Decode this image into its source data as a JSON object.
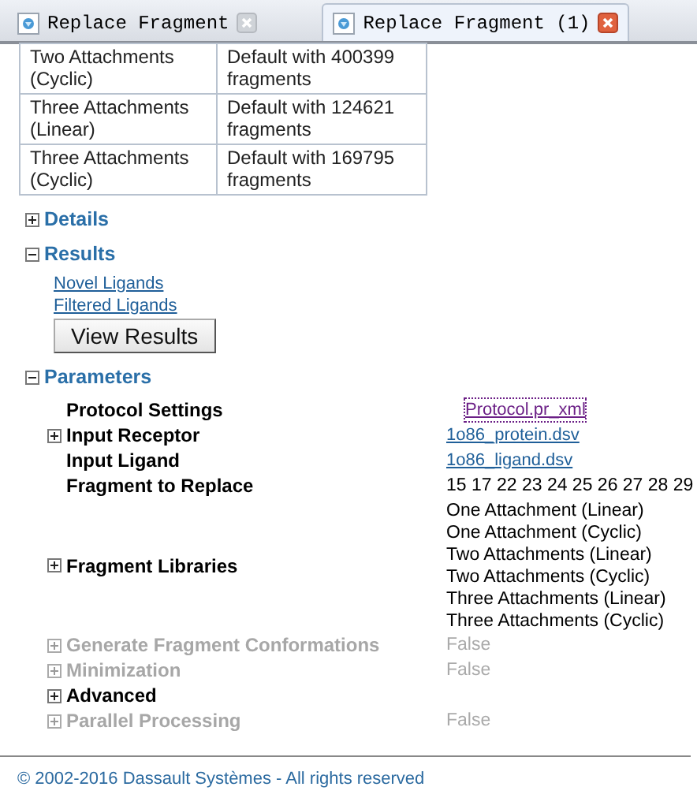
{
  "tabs": [
    {
      "title": "Replace Fragment",
      "selected": false
    },
    {
      "title": "Replace Fragment (1)",
      "selected": true
    }
  ],
  "libraries_table": {
    "rows": [
      {
        "library": "Two Attachments (Cyclic)",
        "description": "Default with 400399 fragments"
      },
      {
        "library": "Three Attachments (Linear)",
        "description": "Default with 124621 fragments"
      },
      {
        "library": "Three Attachments (Cyclic)",
        "description": "Default with 169795 fragments"
      }
    ]
  },
  "sections": [
    {
      "title": "Details",
      "expanded": false
    },
    {
      "title": "Results",
      "expanded": true,
      "links": [
        "Novel Ligands",
        "Filtered Ligands"
      ],
      "button": "View Results"
    },
    {
      "title": "Parameters",
      "expanded": true,
      "parameters": [
        {
          "label": "Protocol Settings",
          "expandable": false,
          "disabled": false,
          "kind": "link",
          "value": "Protocol.pr_xml",
          "visited": true
        },
        {
          "label": "Input Receptor",
          "expandable": true,
          "disabled": false,
          "kind": "link",
          "value": "1o86_protein.dsv",
          "visited": false
        },
        {
          "label": "Input Ligand",
          "expandable": false,
          "disabled": false,
          "kind": "link",
          "value": "1o86_ligand.dsv",
          "visited": false
        },
        {
          "label": "Fragment to Replace",
          "expandable": false,
          "disabled": false,
          "kind": "text",
          "value": "15 17 22 23 24 25 26 27 28 29"
        },
        {
          "label": "Fragment Libraries",
          "expandable": true,
          "disabled": false,
          "kind": "list",
          "values": [
            "One Attachment (Linear)",
            "One Attachment (Cyclic)",
            "Two Attachments (Linear)",
            "Two Attachments (Cyclic)",
            "Three Attachments (Linear)",
            "Three Attachments (Cyclic)"
          ]
        },
        {
          "label": "Generate Fragment Conformations",
          "expandable": true,
          "disabled": true,
          "kind": "text",
          "value": "False"
        },
        {
          "label": "Minimization",
          "expandable": true,
          "disabled": true,
          "kind": "text",
          "value": "False"
        },
        {
          "label": "Advanced",
          "expandable": true,
          "disabled": false,
          "kind": "none"
        },
        {
          "label": "Parallel Processing",
          "expandable": true,
          "disabled": true,
          "kind": "text",
          "value": "False"
        }
      ]
    }
  ],
  "footer": "© 2002-2016 Dassault Systèmes - All rights reserved"
}
